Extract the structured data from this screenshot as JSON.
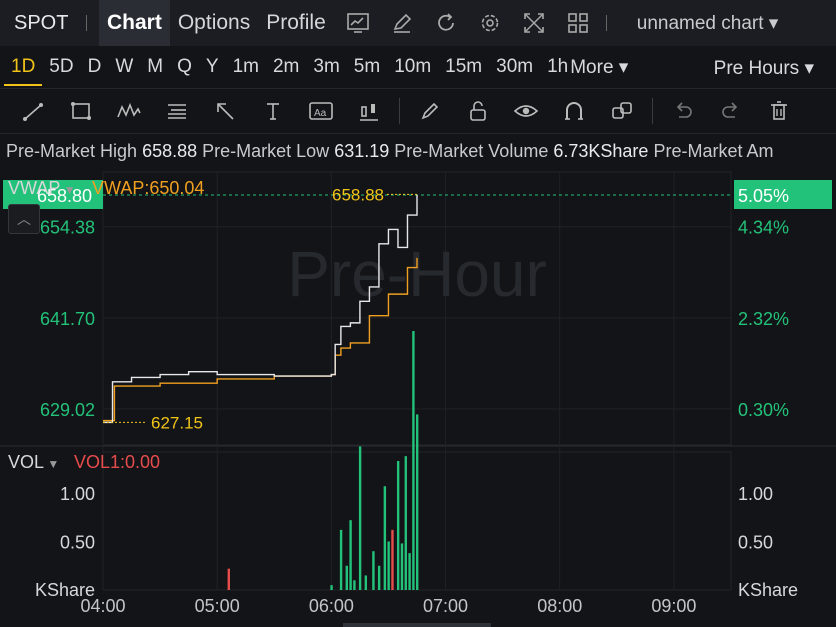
{
  "symbol": "SPOT",
  "nav_tabs": [
    "Chart",
    "Options",
    "Profile"
  ],
  "chart_name": "unnamed chart",
  "timeframes": [
    "1D",
    "5D",
    "D",
    "W",
    "M",
    "Q",
    "Y",
    "1m",
    "2m",
    "3m",
    "5m",
    "10m",
    "15m",
    "30m",
    "1h"
  ],
  "more_label": "More",
  "session_label": "Pre Hours",
  "info": {
    "high_label": "Pre-Market High",
    "high_value": "658.88",
    "low_label": "Pre-Market Low",
    "low_value": "631.19",
    "vol_label": "Pre-Market Volume",
    "vol_value": "6.73KShare",
    "amt_label": "Pre-Market Am"
  },
  "price_panel": {
    "indicator": "VWAP",
    "indicator_value": "VWAP:650.04",
    "watermark": "Pre-Hour",
    "current_price": "658.80",
    "current_pct": "5.05%",
    "left_ticks": [
      "654.38",
      "641.70",
      "629.02"
    ],
    "right_ticks": [
      "4.34%",
      "2.32%",
      "0.30%"
    ],
    "high_marker": "658.88",
    "low_marker": "627.15"
  },
  "volume_panel": {
    "indicator": "VOL",
    "indicator_value": "VOL1:0.00",
    "ticks": [
      "1.00",
      "0.50"
    ],
    "unit": "KShare"
  },
  "time_axis": [
    "04:00",
    "05:00",
    "06:00",
    "07:00",
    "08:00",
    "09:00"
  ],
  "colors": {
    "up": "#23c27a",
    "down": "#e74c4c",
    "accent": "#f0c419",
    "vwap": "#f0a020",
    "price": "#e8e8ea"
  },
  "chart_data": {
    "type": "line",
    "series": [
      {
        "name": "VWAP",
        "x": [
          "04:00",
          "04:06",
          "04:30",
          "05:00",
          "05:30",
          "06:00",
          "06:02",
          "06:05",
          "06:10",
          "06:20",
          "06:30",
          "06:40",
          "06:45"
        ],
        "values": [
          627.4,
          632.2,
          632.6,
          633.2,
          633.6,
          633.8,
          636.5,
          637.5,
          638.2,
          642,
          645,
          648.7,
          650.04
        ]
      },
      {
        "name": "Price",
        "x": [
          "04:00",
          "04:05",
          "04:15",
          "04:30",
          "04:45",
          "05:00",
          "05:30",
          "06:00",
          "06:02",
          "06:05",
          "06:10",
          "06:15",
          "06:20",
          "06:25",
          "06:30",
          "06:35",
          "06:40",
          "06:45"
        ],
        "values": [
          627.15,
          632.8,
          633.4,
          633.8,
          634.2,
          633.8,
          633.6,
          633.8,
          638,
          640.5,
          641,
          644,
          646,
          652,
          654,
          651.5,
          656,
          658.8
        ]
      }
    ],
    "volume": {
      "x": [
        "05:06",
        "06:00",
        "06:05",
        "06:08",
        "06:10",
        "06:12",
        "06:15",
        "06:18",
        "06:22",
        "06:25",
        "06:28",
        "06:30",
        "06:32",
        "06:35",
        "06:37",
        "06:39",
        "06:41",
        "06:43",
        "06:45"
      ],
      "values": [
        0.22,
        0.05,
        0.62,
        0.25,
        0.72,
        0.1,
        1.48,
        0.15,
        0.4,
        0.25,
        1.07,
        0.5,
        0.62,
        1.33,
        0.48,
        1.38,
        0.38,
        2.67,
        1.81
      ],
      "up": [
        false,
        true,
        true,
        true,
        true,
        true,
        true,
        true,
        true,
        true,
        true,
        true,
        false,
        true,
        true,
        true,
        true,
        true,
        true
      ]
    },
    "ylim": [
      624,
      662
    ],
    "xlim": [
      "04:00",
      "09:30"
    ]
  }
}
